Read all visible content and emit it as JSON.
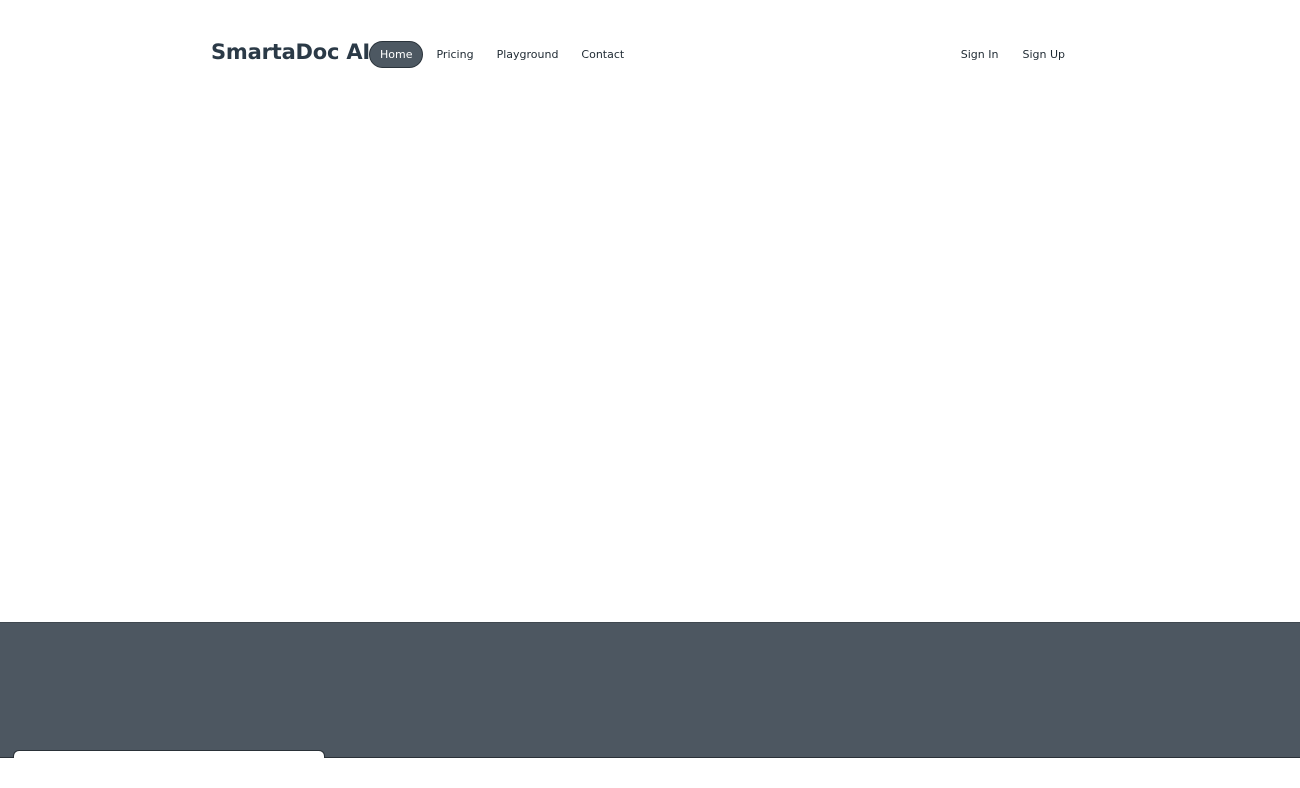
{
  "brand": {
    "name": "SmartaDoc AI"
  },
  "nav": {
    "items": [
      {
        "label": "Home",
        "active": true
      },
      {
        "label": "Pricing",
        "active": false
      },
      {
        "label": "Playground",
        "active": false
      },
      {
        "label": "Contact",
        "active": false
      }
    ]
  },
  "auth": {
    "sign_in": "Sign In",
    "sign_up": "Sign Up"
  },
  "colors": {
    "brand_text": "#2b3a47",
    "active_pill": "#4d5862",
    "footer_bg": "#4d5761"
  }
}
